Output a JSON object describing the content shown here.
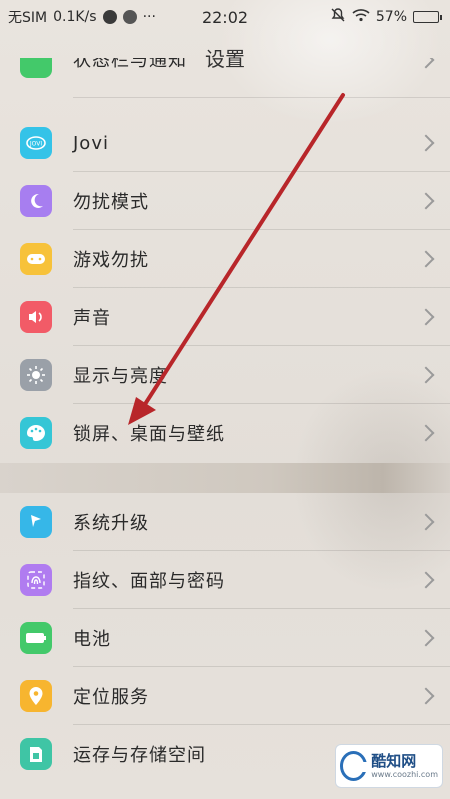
{
  "status_bar": {
    "carrier": "无SIM",
    "speed": "0.1K/s",
    "time": "22:02",
    "battery_percent": "57%",
    "battery_level": 0.57
  },
  "header": {
    "title": "设置"
  },
  "partial_item": {
    "label": "状态栏与通知"
  },
  "items": [
    {
      "label": "Jovi",
      "icon": "jovi-icon",
      "color": "#34c3e8"
    },
    {
      "label": "勿扰模式",
      "icon": "moon-icon",
      "color": "#a77ef0"
    },
    {
      "label": "游戏勿扰",
      "icon": "gamepad-icon",
      "color": "#f7c23a"
    },
    {
      "label": "声音",
      "icon": "speaker-icon",
      "color": "#f25b67"
    },
    {
      "label": "显示与亮度",
      "icon": "sun-icon",
      "color": "#9aa0a8"
    },
    {
      "label": "锁屏、桌面与壁纸",
      "icon": "palette-icon",
      "color": "#35c6d6"
    },
    {
      "label": "系统升级",
      "icon": "upgrade-icon",
      "color": "#36b7e8"
    },
    {
      "label": "指纹、面部与密码",
      "icon": "fingerprint-icon",
      "color": "#b07cf0"
    },
    {
      "label": "电池",
      "icon": "battery-icon",
      "color": "#43c96a"
    },
    {
      "label": "定位服务",
      "icon": "location-icon",
      "color": "#f7b52f"
    },
    {
      "label": "运存与存储空间",
      "icon": "storage-icon",
      "color": "#3fc5a5"
    }
  ],
  "watermark": {
    "text": "酷知网",
    "url": "www.coozhi.com"
  }
}
